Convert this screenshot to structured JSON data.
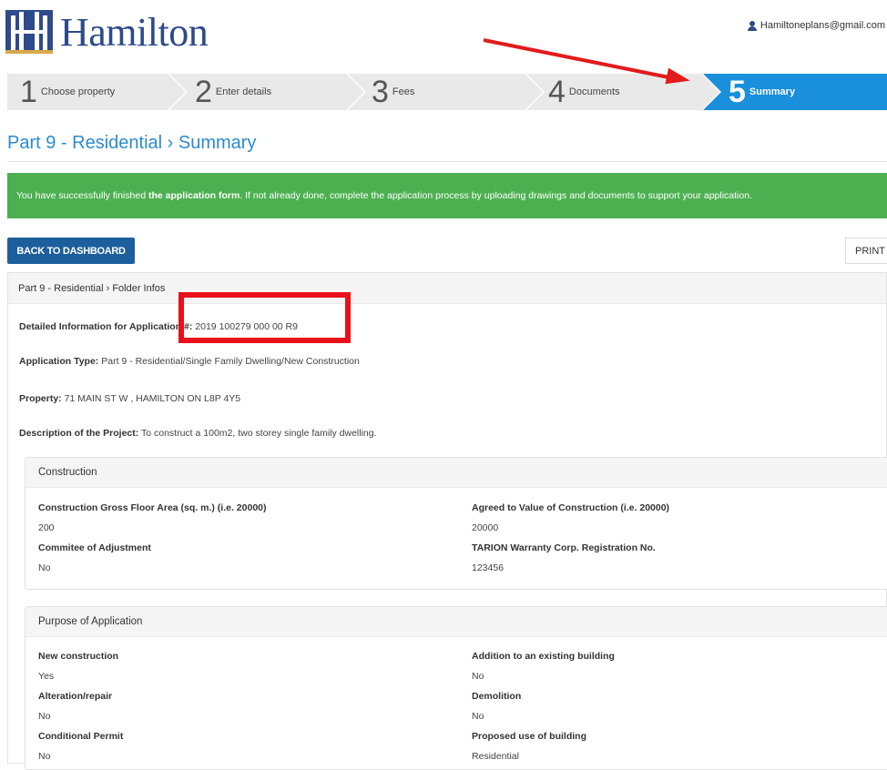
{
  "header": {
    "brand": "Hamilton",
    "user_email": "Hamiltoneplans@gmail.com"
  },
  "steps": [
    {
      "num": "1",
      "label": "Choose property",
      "active": false
    },
    {
      "num": "2",
      "label": "Enter details",
      "active": false
    },
    {
      "num": "3",
      "label": "Fees",
      "active": false
    },
    {
      "num": "4",
      "label": "Documents",
      "active": false
    },
    {
      "num": "5",
      "label": "Summary",
      "active": true
    }
  ],
  "page_title": "Part 9 - Residential › Summary",
  "alert": {
    "pre": "You have successfully finished ",
    "bold": "the application form",
    "post": ". If not already done, complete the application process by uploading drawings and documents to support your application."
  },
  "actions": {
    "back_label": "BACK TO DASHBOARD",
    "print_label": "PRINT"
  },
  "folder": {
    "heading": "Part 9 - Residential › Folder Infos",
    "lines": [
      {
        "label": "Detailed Information for Application #:",
        "value": " 2019 100279 000 00 R9"
      },
      {
        "label": "Application Type:",
        "value": " Part 9 - Residential/Single Family Dwelling/New Construction"
      },
      {
        "label": "Property:",
        "value": " 71 MAIN ST W , HAMILTON ON L8P 4Y5"
      },
      {
        "label": "Description of the Project:",
        "value": " To construct a 100m2, two storey single family dwelling."
      }
    ]
  },
  "construction": {
    "heading": "Construction",
    "fields": [
      {
        "label": "Construction Gross Floor Area (sq. m.) (i.e. 20000)",
        "value": "200"
      },
      {
        "label": "Agreed to Value of Construction (i.e. 20000)",
        "value": "20000"
      },
      {
        "label": "Commitee of Adjustment",
        "value": "No"
      },
      {
        "label": "TARION Warranty Corp. Registration No.",
        "value": "123456"
      }
    ]
  },
  "purpose": {
    "heading": "Purpose of Application",
    "fields": [
      {
        "label": "New construction",
        "value": "Yes"
      },
      {
        "label": "Addition to an existing building",
        "value": "No"
      },
      {
        "label": "Alteration/repair",
        "value": "No"
      },
      {
        "label": "Demolition",
        "value": "No"
      },
      {
        "label": "Conditional Permit",
        "value": "No"
      },
      {
        "label": "Proposed use of building",
        "value": "Residential"
      }
    ]
  },
  "colors": {
    "accent": "#2b8ad1",
    "step_active": "#1a8fdc",
    "step_inactive": "#e9e9e9",
    "success": "#4cb050",
    "button": "#1d5f9c",
    "annotation": "#e21b1b"
  }
}
